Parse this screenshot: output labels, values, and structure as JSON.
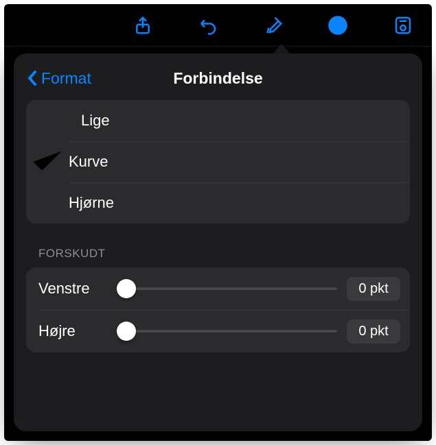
{
  "toolbar": {
    "icons": [
      "share-icon",
      "undo-icon",
      "format-brush-icon",
      "more-icon",
      "presenter-icon"
    ]
  },
  "popover": {
    "back_label": "Format",
    "title": "Forbindelse",
    "options": [
      {
        "label": "Lige",
        "selected": false
      },
      {
        "label": "Kurve",
        "selected": true
      },
      {
        "label": "Hjørne",
        "selected": false
      }
    ],
    "offset_section_label": "Forskudt",
    "offsets": [
      {
        "label": "Venstre",
        "value_text": "0 pkt",
        "fraction": 0
      },
      {
        "label": "Højre",
        "value_text": "0 pkt",
        "fraction": 0
      }
    ]
  },
  "colors": {
    "accent": "#0a84ff"
  }
}
